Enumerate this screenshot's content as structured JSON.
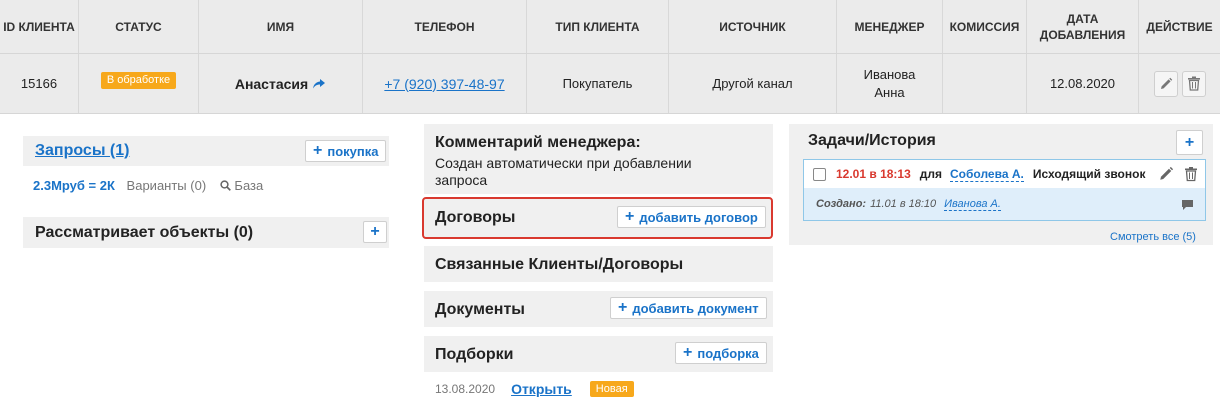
{
  "table": {
    "headers": {
      "id": "ID КЛИЕНТА",
      "status": "СТАТУС",
      "name": "ИМЯ",
      "phone": "ТЕЛЕФОН",
      "client_type": "ТИП КЛИЕНТА",
      "source": "ИСТОЧНИК",
      "manager": "МЕНЕДЖЕР",
      "commission": "КОМИССИЯ",
      "date_added": "ДАТА ДОБАВЛЕНИЯ",
      "action": "ДЕЙСТВИЕ"
    },
    "row": {
      "id": "15166",
      "status": "В обработке",
      "name": "Анастасия",
      "phone": "+7 (920) 397-48-97",
      "client_type": "Покупатель",
      "source": "Другой канал",
      "manager_line1": "Иванова",
      "manager_line2": "Анна",
      "commission": "",
      "date_added": "12.08.2020"
    }
  },
  "requests": {
    "title": "Запросы (1)",
    "add_label": "покупка",
    "price": "2.3Мруб = 2К",
    "variants": "Варианты (0)",
    "base": "База"
  },
  "objects": {
    "title": "Рассматривает объекты (0)"
  },
  "comment": {
    "title": "Комментарий менеджера:",
    "text_line1": "Создан автоматически при добавлении",
    "text_line2": "запроса"
  },
  "contracts": {
    "title": "Договоры",
    "add_label": "добавить договор"
  },
  "related": {
    "title": "Связанные Клиенты/Договоры"
  },
  "documents": {
    "title": "Документы",
    "add_label": "добавить документ"
  },
  "selections": {
    "title": "Подборки",
    "add_label": "подборка",
    "date": "13.08.2020",
    "open_label": "Открыть",
    "badge": "Новая"
  },
  "tasks": {
    "title": "Задачи/История",
    "task": {
      "time": "12.01 в 18:13",
      "for_label": "для",
      "assignee": "Соболева А.",
      "type": "Исходящий звонок",
      "created_label": "Создано:",
      "created_time": "11.01 в 18:10",
      "creator": "Иванова А."
    },
    "see_all": "Смотреть все (5)"
  },
  "colors": {
    "accent": "#1a73c8",
    "badge": "#f7a81b",
    "highlight": "#d9392f",
    "task_time": "#d9392f"
  }
}
